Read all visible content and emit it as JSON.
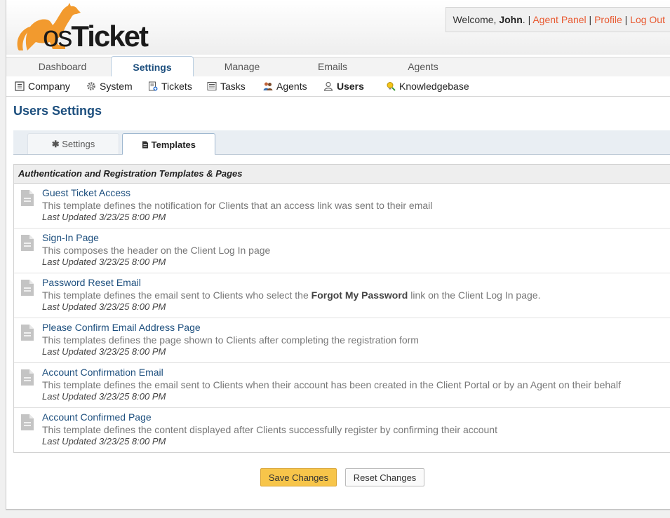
{
  "header": {
    "logo_text": "osTicket",
    "welcome_prefix": "Welcome, ",
    "user_name": "John",
    "welcome_suffix": ". | ",
    "links": [
      "Agent Panel",
      "Profile",
      "Log Out"
    ],
    "separator": " | "
  },
  "nav": {
    "tabs": [
      "Dashboard",
      "Settings",
      "Manage",
      "Emails",
      "Agents"
    ],
    "active": "Settings"
  },
  "subnav": {
    "items": [
      {
        "label": "Company",
        "icon": "building-icon"
      },
      {
        "label": "System",
        "icon": "gear-icon"
      },
      {
        "label": "Tickets",
        "icon": "ticket-icon"
      },
      {
        "label": "Tasks",
        "icon": "tasks-icon"
      },
      {
        "label": "Agents",
        "icon": "agents-icon"
      },
      {
        "label": "Users",
        "icon": "user-icon"
      },
      {
        "label": "Knowledgebase",
        "icon": "knowledgebase-icon"
      }
    ],
    "active": "Users"
  },
  "page": {
    "title": "Users Settings",
    "tabs": [
      {
        "label": "Settings",
        "icon": "asterisk-icon"
      },
      {
        "label": "Templates",
        "icon": "file-icon"
      }
    ],
    "active_tab": "Templates"
  },
  "templates": {
    "heading": "Authentication and Registration Templates & Pages",
    "items": [
      {
        "title": "Guest Ticket Access",
        "desc": "This template defines the notification for Clients that an access link was sent to their email",
        "updated": "Last Updated 3/23/25 8:00 PM"
      },
      {
        "title": "Sign-In Page",
        "desc": "This composes the header on the Client Log In page",
        "updated": "Last Updated 3/23/25 8:00 PM"
      },
      {
        "title": "Password Reset Email",
        "desc_pre": "This template defines the email sent to Clients who select the ",
        "desc_bold": "Forgot My Password",
        "desc_post": " link on the Client Log In page.",
        "updated": "Last Updated 3/23/25 8:00 PM"
      },
      {
        "title": "Please Confirm Email Address Page",
        "desc": "This templates defines the page shown to Clients after completing the registration form",
        "updated": "Last Updated 3/23/25 8:00 PM"
      },
      {
        "title": "Account Confirmation Email",
        "desc": "This template defines the email sent to Clients when their account has been created in the Client Portal or by an Agent on their behalf",
        "updated": "Last Updated 3/23/25 8:00 PM"
      },
      {
        "title": "Account Confirmed Page",
        "desc": "This template defines the content displayed after Clients successfully register by confirming their account",
        "updated": "Last Updated 3/23/25 8:00 PM"
      }
    ]
  },
  "buttons": {
    "save": "Save Changes",
    "reset": "Reset Changes"
  },
  "colors": {
    "accent": "#1d4f7e",
    "link_orange": "#e8582f",
    "save_button": "#f7c54a",
    "logo_orange": "#f29a2e"
  }
}
